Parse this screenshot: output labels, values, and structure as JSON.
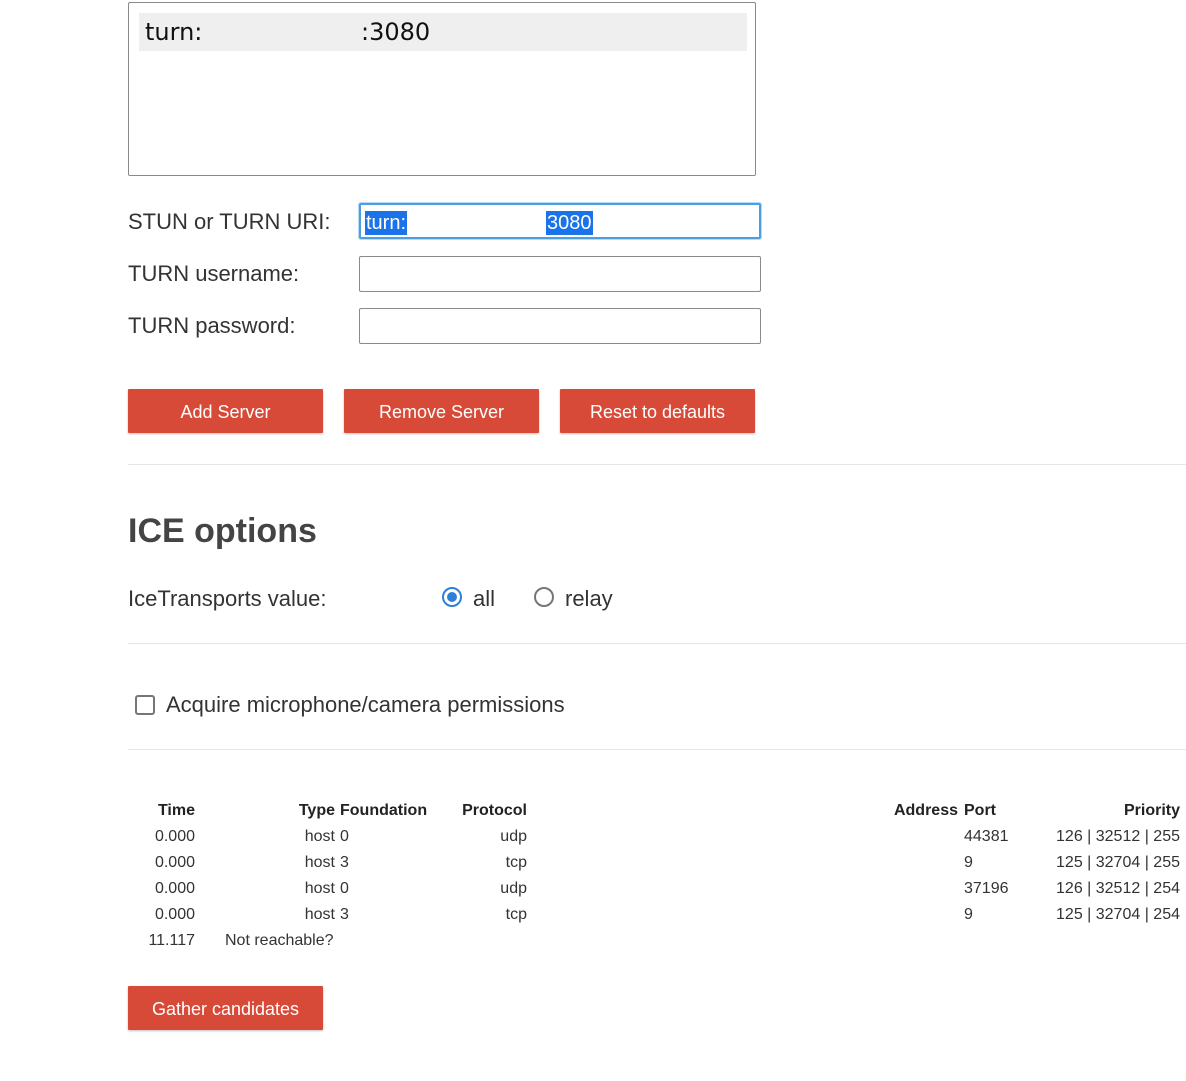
{
  "servers": {
    "list_items": [
      {
        "prefix": "turn:",
        "suffix": ":3080"
      }
    ]
  },
  "form": {
    "uri_label": "STUN or TURN URI:",
    "uri_value_prefix": "turn:",
    "uri_value_suffix": "3080",
    "username_label": "TURN username:",
    "username_value": "",
    "password_label": "TURN password:",
    "password_value": ""
  },
  "buttons": {
    "add": "Add Server",
    "remove": "Remove Server",
    "reset": "Reset to defaults",
    "gather": "Gather candidates"
  },
  "ice": {
    "title": "ICE options",
    "transports_label": "IceTransports value:",
    "options": [
      {
        "label": "all",
        "checked": true
      },
      {
        "label": "relay",
        "checked": false
      }
    ]
  },
  "permissions": {
    "label": "Acquire microphone/camera permissions",
    "checked": false
  },
  "candidates": {
    "headers": {
      "time": "Time",
      "type": "Type",
      "foundation": "Foundation",
      "protocol": "Protocol",
      "address": "Address",
      "port": "Port",
      "priority": "Priority"
    },
    "rows": [
      {
        "time": "0.000",
        "type": "host",
        "foundation": "0",
        "protocol": "udp",
        "port": "44381",
        "priority": "126 | 32512 | 255"
      },
      {
        "time": "0.000",
        "type": "host",
        "foundation": "3",
        "protocol": "tcp",
        "port": "9",
        "priority": "125 | 32704 | 255"
      },
      {
        "time": "0.000",
        "type": "host",
        "foundation": "0",
        "protocol": "udp",
        "port": "37196",
        "priority": "126 | 32512 | 254"
      },
      {
        "time": "0.000",
        "type": "host",
        "foundation": "3",
        "protocol": "tcp",
        "port": "9",
        "priority": "125 | 32704 | 254"
      }
    ],
    "final_row": {
      "time": "11.117",
      "message": "Not reachable?"
    }
  }
}
